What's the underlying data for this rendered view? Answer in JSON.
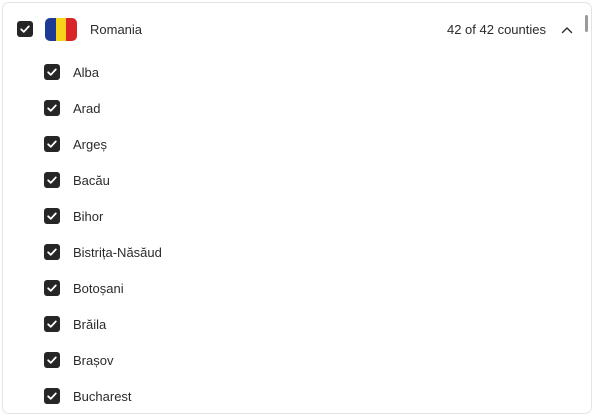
{
  "country": {
    "name": "Romania",
    "count_text": "42 of 42 counties",
    "checked": true,
    "flag_colors": [
      "#1f3a94",
      "#f7d417",
      "#d9242a"
    ],
    "expanded_icon": "chevron-up-icon"
  },
  "colors": {
    "checkbox_fill": "#262626",
    "text": "#2b2b2b",
    "border": "#e3e3e3"
  },
  "counties": [
    {
      "label": "Alba",
      "checked": true
    },
    {
      "label": "Arad",
      "checked": true
    },
    {
      "label": "Argeș",
      "checked": true
    },
    {
      "label": "Bacău",
      "checked": true
    },
    {
      "label": "Bihor",
      "checked": true
    },
    {
      "label": "Bistrița-Năsăud",
      "checked": true
    },
    {
      "label": "Botoșani",
      "checked": true
    },
    {
      "label": "Brăila",
      "checked": true
    },
    {
      "label": "Brașov",
      "checked": true
    },
    {
      "label": "Bucharest",
      "checked": true
    }
  ]
}
